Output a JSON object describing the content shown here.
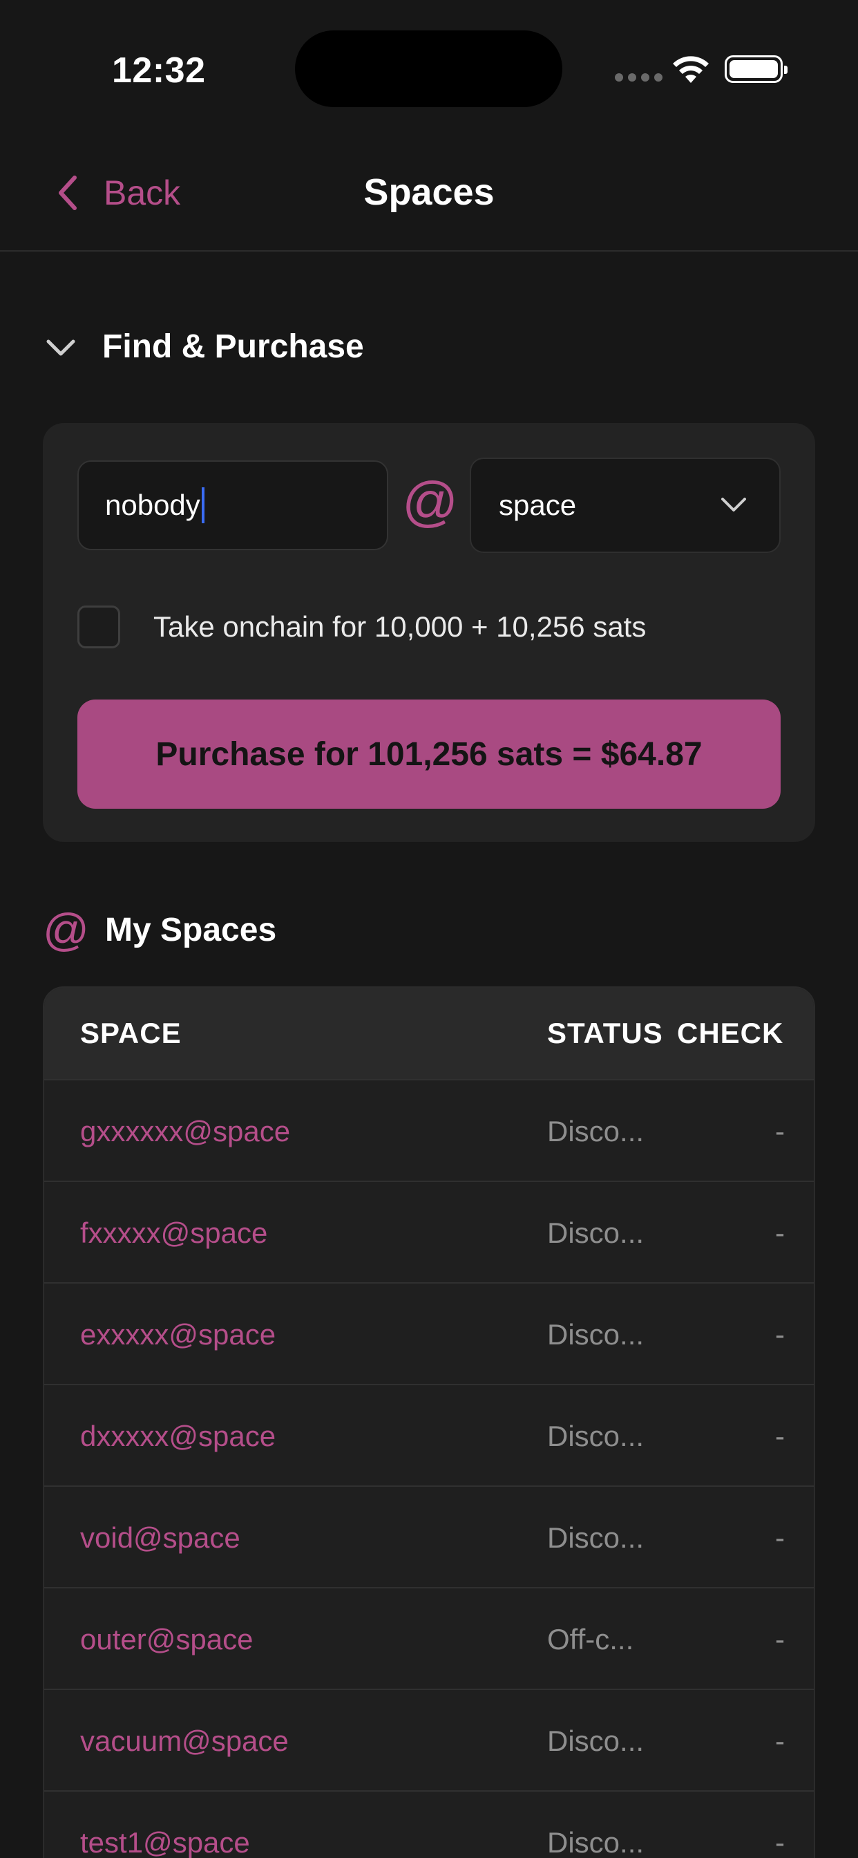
{
  "status_bar": {
    "time": "12:32"
  },
  "nav": {
    "back_label": "Back",
    "title": "Spaces"
  },
  "find": {
    "header": "Find & Purchase",
    "name_value": "nobody",
    "at_symbol": "@",
    "domain_selected": "space",
    "onchain_label": "Take onchain for 10,000 + 10,256 sats",
    "onchain_checked": false,
    "purchase_label": "Purchase for 101,256 sats = $64.87"
  },
  "my_spaces": {
    "header": "My Spaces",
    "header_icon": "@",
    "columns": {
      "space": "SPACE",
      "status": "STATUS",
      "check": "CHECK"
    },
    "rows": [
      {
        "space": "gxxxxxx@space",
        "status": "Disco...",
        "check": "-"
      },
      {
        "space": "fxxxxx@space",
        "status": "Disco...",
        "check": "-"
      },
      {
        "space": "exxxxx@space",
        "status": "Disco...",
        "check": "-"
      },
      {
        "space": "dxxxxx@space",
        "status": "Disco...",
        "check": "-"
      },
      {
        "space": "void@space",
        "status": "Disco...",
        "check": "-"
      },
      {
        "space": "outer@space",
        "status": "Off-c...",
        "check": "-"
      },
      {
        "space": "vacuum@space",
        "status": "Disco...",
        "check": "-"
      },
      {
        "space": "test1@space",
        "status": "Disco...",
        "check": "-"
      }
    ]
  },
  "colors": {
    "accent": "#b54e8a",
    "button": "#a94a82",
    "background": "#171717",
    "card": "#232323"
  }
}
